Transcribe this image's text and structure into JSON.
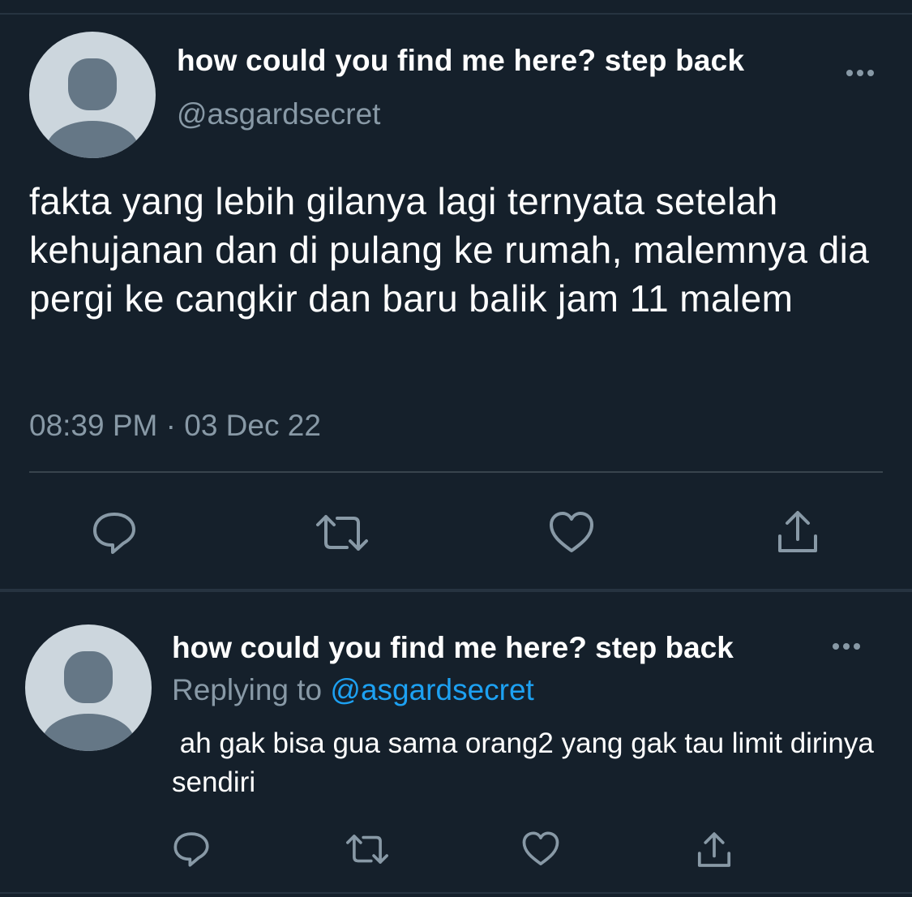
{
  "main_tweet": {
    "display_name": "how could you find me here? step back",
    "handle": "@asgardsecret",
    "text": "fakta yang lebih gilanya lagi ternyata setelah kehujanan dan di pulang ke rumah, malemnya dia pergi ke cangkir dan baru balik jam 11 malem",
    "timestamp": "08:39 PM · 03 Dec 22",
    "actions": [
      "reply-icon",
      "retweet-icon",
      "like-icon",
      "share-icon"
    ]
  },
  "reply_tweet": {
    "display_name": "how could you find me here? step back",
    "replying_prefix": "Replying to",
    "replying_to": "@asgardsecret",
    "text": " ah gak bisa gua sama orang2 yang gak tau limit dirinya sendiri",
    "actions": [
      "reply-icon",
      "retweet-icon",
      "like-icon",
      "share-icon"
    ]
  },
  "colors": {
    "background": "#15202b",
    "secondary_text": "#8899a6",
    "link": "#1da1f2",
    "divider": "#38444d"
  }
}
